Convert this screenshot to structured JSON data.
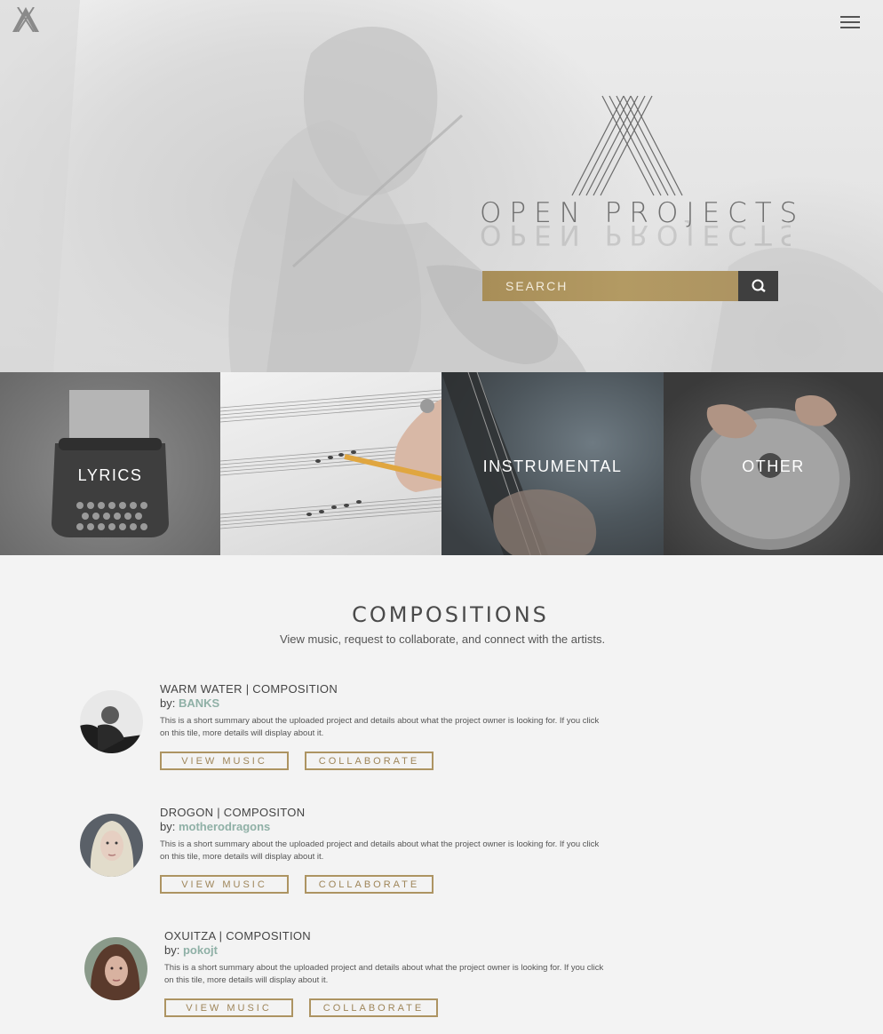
{
  "header": {
    "logo_icon": "open-projects-x-mark",
    "menu_icon": "hamburger-menu-icon"
  },
  "hero": {
    "brand_name": "OPEN PROJECTS",
    "search": {
      "placeholder": "SEARCH",
      "button_icon": "search-icon"
    }
  },
  "categories": [
    {
      "label": "LYRICS"
    },
    {
      "label": ""
    },
    {
      "label": "INSTRUMENTAL"
    },
    {
      "label": "OTHER"
    }
  ],
  "compositions": {
    "title": "COMPOSITIONS",
    "subtitle": "View music, request to collaborate, and connect with the artists.",
    "items": [
      {
        "title": "WARM WATER | COMPOSITION",
        "by_prefix": "by:",
        "artist": "BANKS",
        "description": "This is a short summary about the uploaded project and details about what the project owner is looking for. If you click on this tile, more details will display about it.",
        "view_label": "VIEW MUSIC",
        "collab_label": "COLLABORATE"
      },
      {
        "title": "DROGON | COMPOSITON",
        "by_prefix": "by:",
        "artist": "motherodragons",
        "description": "This is a short summary about the uploaded project and details about what the project owner is looking for. If you click on this tile, more details will display about it.",
        "view_label": "VIEW MUSIC",
        "collab_label": "COLLABORATE"
      },
      {
        "title": "OXUITZA | COMPOSITION",
        "by_prefix": "by:",
        "artist": "pokojt",
        "description": "This is a short summary about the uploaded project and details about what the project owner is looking for. If you click on this tile, more details will display about it.",
        "view_label": "VIEW MUSIC",
        "collab_label": "COLLABORATE"
      }
    ]
  },
  "colors": {
    "accent_gold": "#ad9462",
    "artist_link": "#8fb0a6",
    "dark_button": "#3f3f3f",
    "page_background": "#f3f3f3"
  }
}
